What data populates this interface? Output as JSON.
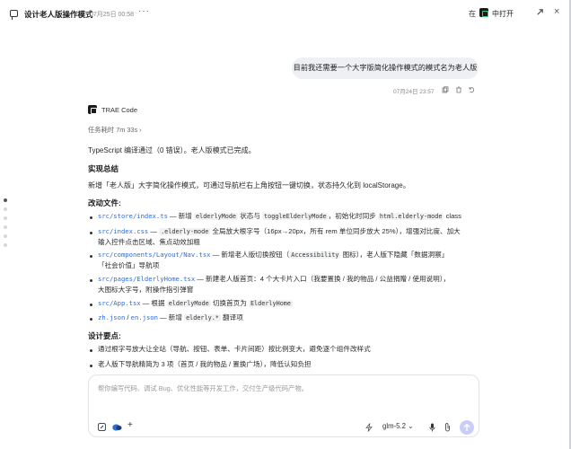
{
  "header": {
    "title": "设计老人版操作模式",
    "time": "07月25日 00:58",
    "more": "···",
    "in_label": "在",
    "open_label": "中打开"
  },
  "user_message": {
    "text": "目前我还需要一个大字版简化操作模式的模式名为老人版",
    "meta": "07月24日 23:57"
  },
  "assistant": {
    "name": "TRAE Code",
    "task_time": "任务耗时 7m 33s ›",
    "status": "TypeScript 编译通过（0 错误）。老人版模式已完成。",
    "summary_heading": "实现总结",
    "summary_text": "新增「老人版」大字简化操作模式，可通过导航栏右上角按钮一键切换，状态持久化到 localStorage。",
    "changes_heading": "改动文件:",
    "changes": [
      {
        "file": "src/store/index.ts",
        "sep": " — 新增 ",
        "c1": "elderlyMode",
        "t1": " 状态与 ",
        "c2": "toggleElderlyMode",
        "t2": "，初始化时同步 ",
        "c3": "html.elderly-mode",
        "t3": " class"
      },
      {
        "file": "src/index.css",
        "sep": " — ",
        "c1": ".elderly-mode",
        "t1": " 全局放大根字号（16px→20px，所有 rem 单位同步放大 25%），增强对比度、加大",
        "line2": "输入控件点击区域、焦点动效加粗"
      },
      {
        "file": "src/components/Layout/Nav.tsx",
        "sep": " — 新增老人版切换按钮（",
        "c1": "Accessibility",
        "t1": " 图标），老人版下隐藏「数据洞察」",
        "line2": "「社会价值」导航项"
      },
      {
        "file": "src/pages/ElderlyHome.tsx",
        "sep": " — 新建老人版首页：4 个大卡片入口（我要置换 / 我的物品 / 公益捐赠 / 使用说明），",
        "line2": "大图标大字号，附操作指引弹窗"
      },
      {
        "file": "src/App.tsx",
        "sep": " — 根据 ",
        "c1": "elderlyMode",
        "t1": " 切换首页为 ",
        "c2": "ElderlyHome"
      },
      {
        "file": "zh.json",
        "mid": " / ",
        "file2": "en.json",
        "sep": " — 新增 ",
        "c1": "elderly.*",
        "t1": " 翻译项"
      }
    ],
    "design_heading": "设计要点:",
    "design_points": [
      "通过根字号放大让全站（导航、按钮、表单、卡片间距）按比例变大，避免逐个组件改样式",
      "老人版下导航精简为 3 项（首页 / 我的物品 / 置换广场），降低认知负担"
    ]
  },
  "input": {
    "placeholder": "帮你编写代码、调试 Bug、优化性能等开发工作，交付生产级代码产物。",
    "model": "glm-5.2 ⌄"
  },
  "colors": {
    "accent": "#2f6bd6",
    "send": "#c9cdf7"
  }
}
